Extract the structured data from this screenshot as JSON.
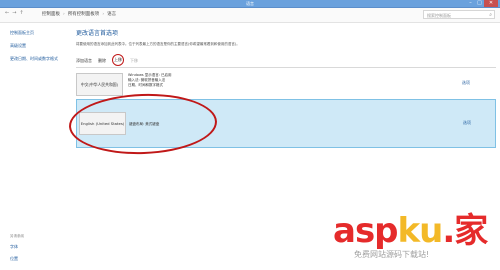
{
  "window": {
    "title": "语言",
    "min": "–",
    "max": "□",
    "close": "✕"
  },
  "address": {
    "back": "←",
    "forward": "→",
    "up": "↑",
    "crumbs": [
      "控制面板",
      "所有控制面板项",
      "语言"
    ],
    "search_placeholder": "搜索控制面板"
  },
  "sidebar": {
    "items": [
      "控制面板主页",
      "高级设置",
      "更改日期、时间或数字格式"
    ],
    "see_also_header": "另请参阅",
    "see_also": [
      "字体",
      "位置"
    ]
  },
  "main": {
    "heading": "更改语言首选项",
    "description": "将要使用的语言添加到此列表中。位于列表最上方的语言是你的主要语言(你希望最常看到和使用的语言)。",
    "toolbar": {
      "add": "添加语言",
      "remove": "删除",
      "up": "上移",
      "down": "下移"
    },
    "languages": [
      {
        "name": "中文(中华人民共和国)",
        "info": "Windows 显示语言: 已启用\n输入法: 微软拼音输入法\n日期、时间和数字格式",
        "option": "选项"
      },
      {
        "name": "English (United States)",
        "info": "键盘布局: 美式键盘",
        "option": "选项"
      }
    ]
  },
  "watermark": {
    "brand_a": "asp",
    "brand_k": "ku",
    "brand_b": ".家",
    "sub": "免费网站源码下载站!"
  }
}
